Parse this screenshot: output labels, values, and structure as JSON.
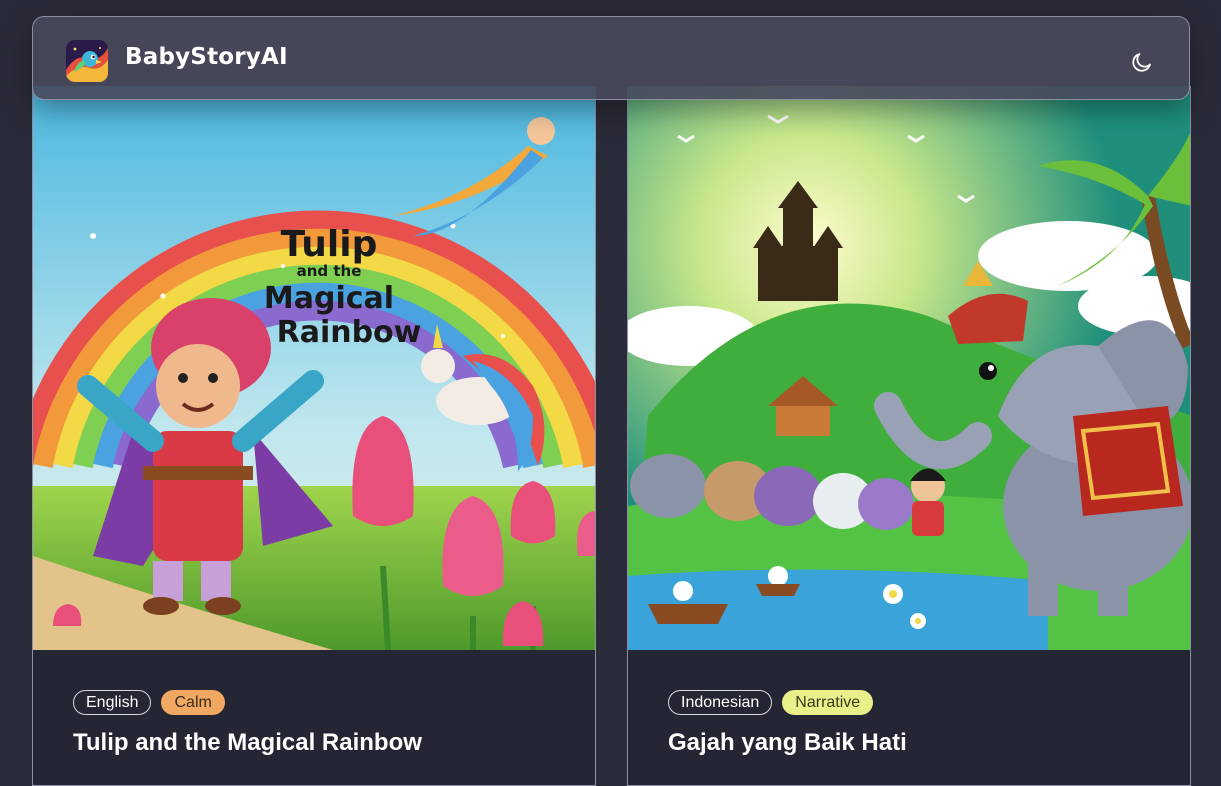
{
  "header": {
    "brand": "BabyStoryAI",
    "logo_icon": "parrot-logo-icon",
    "theme_toggle_icon": "moon-icon"
  },
  "stories": [
    {
      "cover_title_line1": "Tulip",
      "cover_title_line2": "and the",
      "cover_title_line3": "Magical",
      "cover_title_line4": "Rainbow",
      "language": "English",
      "mood": "Calm",
      "title": "Tulip and the Magical Rainbow"
    },
    {
      "language": "Indonesian",
      "mood": "Narrative",
      "title": "Gajah yang Baik Hati"
    }
  ]
}
